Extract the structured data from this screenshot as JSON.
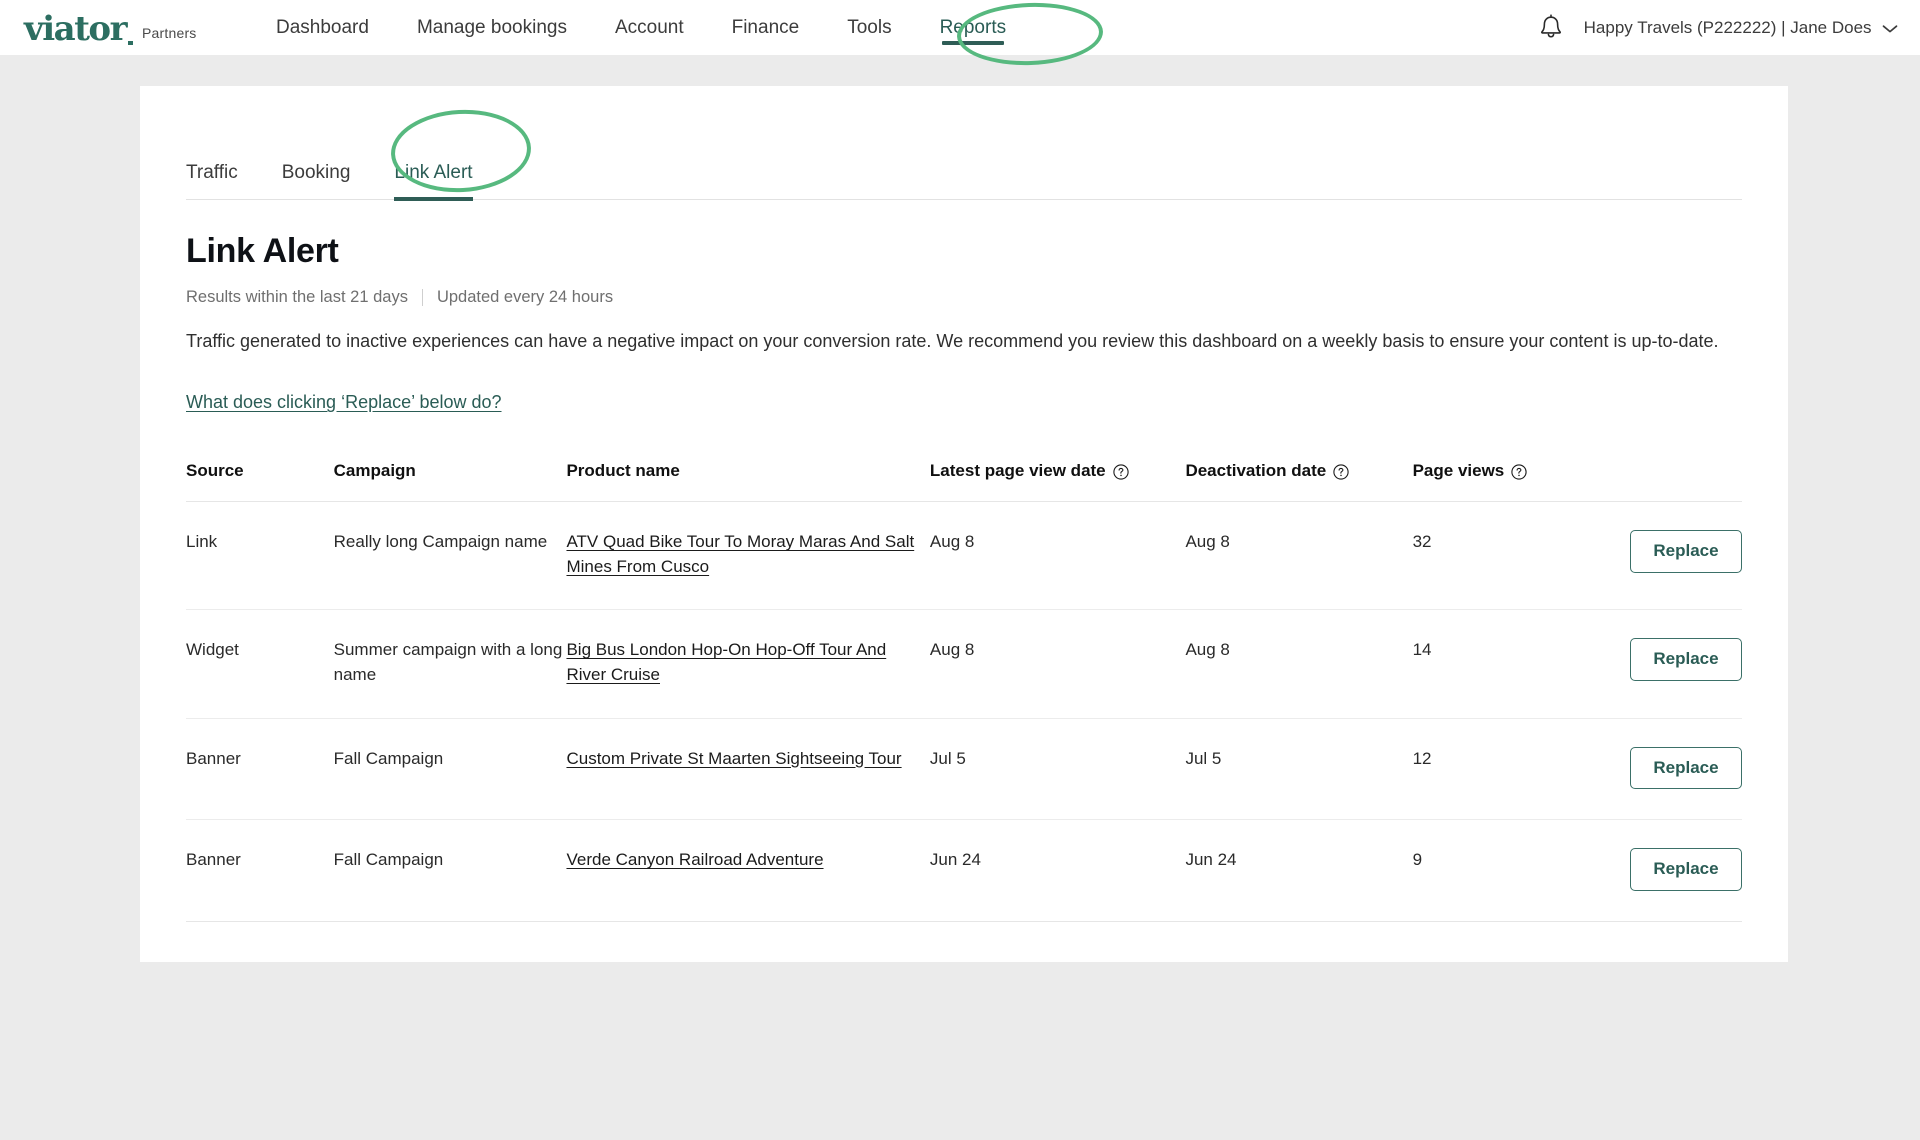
{
  "header": {
    "logo_text": "viator",
    "logo_suffix": "Partners",
    "nav": [
      {
        "label": "Dashboard",
        "active": false
      },
      {
        "label": "Manage bookings",
        "active": false
      },
      {
        "label": "Account",
        "active": false
      },
      {
        "label": "Finance",
        "active": false
      },
      {
        "label": "Tools",
        "active": false
      },
      {
        "label": "Reports",
        "active": true
      }
    ],
    "notification_icon": "bell-icon",
    "account_label": "Happy Travels (P222222) | Jane Does",
    "account_chevron_icon": "chevron-down-icon"
  },
  "subtabs": [
    {
      "label": "Traffic",
      "active": false
    },
    {
      "label": "Booking",
      "active": false
    },
    {
      "label": "Link Alert",
      "active": true
    }
  ],
  "page": {
    "title": "Link Alert",
    "results_window": "Results within the last 21 days",
    "update_cadence": "Updated every 24 hours",
    "description": "Traffic generated to inactive experiences can have a negative impact on your conversion rate. We recommend you review this dashboard on a weekly basis to ensure your content is up-to-date.",
    "help_link": "What does clicking ‘Replace’ below do?"
  },
  "table": {
    "columns": [
      {
        "label": "Source",
        "help": false
      },
      {
        "label": "Campaign",
        "help": false
      },
      {
        "label": "Product name",
        "help": false
      },
      {
        "label": "Latest page view date",
        "help": true
      },
      {
        "label": "Deactivation date",
        "help": true
      },
      {
        "label": "Page views",
        "help": true
      },
      {
        "label": "",
        "help": false
      }
    ],
    "action_label": "Replace",
    "rows": [
      {
        "source": "Link",
        "campaign": "Really long Campaign name",
        "product": "ATV Quad Bike Tour To Moray Maras And Salt Mines From Cusco",
        "latest_page_view_date": "Aug 8",
        "deactivation_date": "Aug 8",
        "page_views": "32",
        "action": "Replace"
      },
      {
        "source": "Widget",
        "campaign": "Summer campaign with a long name",
        "product": "Big Bus London Hop-On Hop-Off Tour And River Cruise",
        "latest_page_view_date": "Aug 8",
        "deactivation_date": "Aug 8",
        "page_views": "14",
        "action": "Replace"
      },
      {
        "source": "Banner",
        "campaign": "Fall Campaign",
        "product": "Custom Private St Maarten Sightseeing Tour",
        "latest_page_view_date": "Jul 5",
        "deactivation_date": "Jul 5",
        "page_views": "12",
        "action": "Replace"
      },
      {
        "source": "Banner",
        "campaign": "Fall Campaign",
        "product": "Verde Canyon Railroad Adventure",
        "latest_page_view_date": "Jun 24",
        "deactivation_date": "Jun 24",
        "page_views": "9",
        "action": "Replace"
      }
    ]
  },
  "annotations": [
    {
      "name": "reports-nav-highlight",
      "color": "#57b97f"
    },
    {
      "name": "link-alert-tab-highlight",
      "color": "#57b97f"
    }
  ],
  "colors": {
    "brand_teal": "#2c6e61",
    "active_underline": "#2f5d56",
    "annotation_green": "#57b97f",
    "page_background": "#ebebeb",
    "card_background": "#ffffff"
  }
}
